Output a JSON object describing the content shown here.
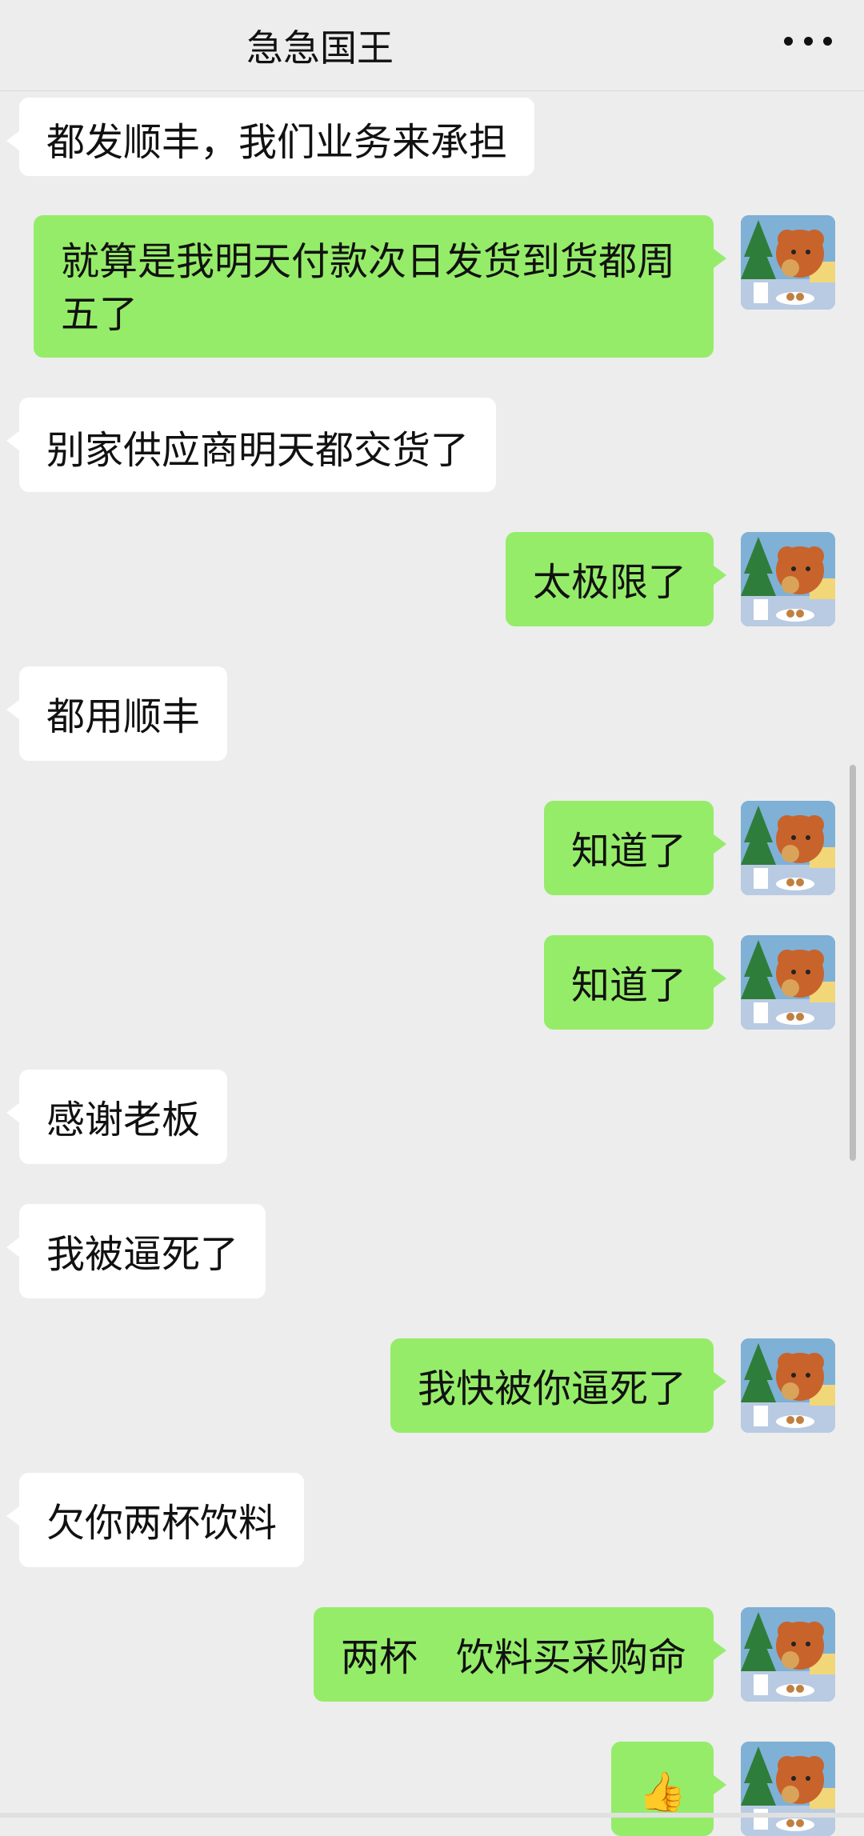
{
  "header": {
    "title": "急急国王",
    "more_icon": "more-dots-icon"
  },
  "messages": [
    {
      "side": "left",
      "text": "都发顺丰，我们业务来承担"
    },
    {
      "side": "right",
      "text": "就算是我明天付款次日发货到货都周五了"
    },
    {
      "side": "left",
      "text": "别家供应商明天都交货了"
    },
    {
      "side": "right",
      "text": "太极限了"
    },
    {
      "side": "left",
      "text": "都用顺丰"
    },
    {
      "side": "right",
      "text": "知道了"
    },
    {
      "side": "right",
      "text": "知道了"
    },
    {
      "side": "left",
      "text": "感谢老板"
    },
    {
      "side": "left",
      "text": "我被逼死了"
    },
    {
      "side": "right",
      "text": "我快被你逼死了"
    },
    {
      "side": "left",
      "text": "欠你两杯饮料"
    },
    {
      "side": "right",
      "text": "两杯　饮料买采购命"
    },
    {
      "side": "right",
      "text": "👍"
    }
  ],
  "avatar": {
    "icon": "dog-eating-cookie-avatar",
    "colors": {
      "bg": "#7fb0d6",
      "dog": "#c8632c",
      "tree": "#2f7d3a"
    }
  },
  "colors": {
    "self_bubble": "#95ec69",
    "other_bubble": "#ffffff",
    "background": "#ededed"
  }
}
